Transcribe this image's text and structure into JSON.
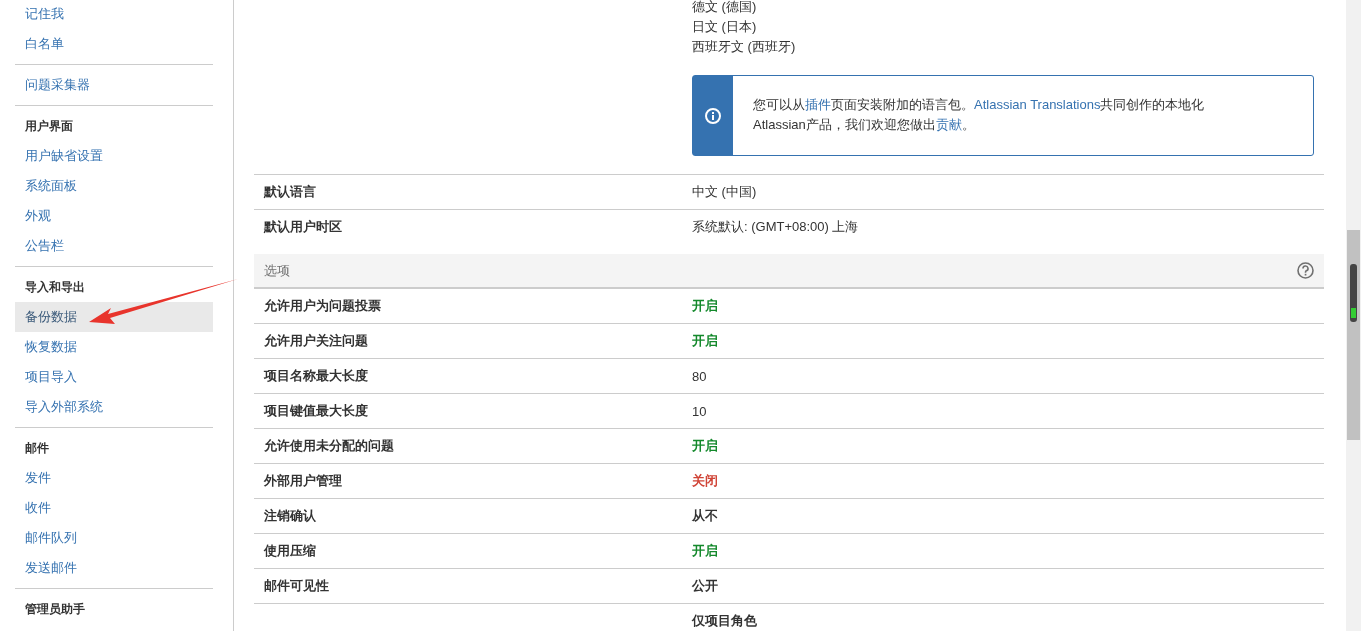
{
  "sidebar": {
    "sections": [
      {
        "items": [
          {
            "label": "记住我",
            "selected": false
          },
          {
            "label": "白名单",
            "selected": false
          }
        ]
      },
      {
        "items": [
          {
            "label": "问题采集器",
            "selected": false
          }
        ]
      },
      {
        "heading": "用户界面",
        "items": [
          {
            "label": "用户缺省设置",
            "selected": false
          },
          {
            "label": "系统面板",
            "selected": false
          },
          {
            "label": "外观",
            "selected": false
          },
          {
            "label": "公告栏",
            "selected": false
          }
        ]
      },
      {
        "heading": "导入和导出",
        "items": [
          {
            "label": "备份数据",
            "selected": true
          },
          {
            "label": "恢复数据",
            "selected": false
          },
          {
            "label": "项目导入",
            "selected": false
          },
          {
            "label": "导入外部系统",
            "selected": false
          }
        ]
      },
      {
        "heading": "邮件",
        "items": [
          {
            "label": "发件",
            "selected": false
          },
          {
            "label": "收件",
            "selected": false
          },
          {
            "label": "邮件队列",
            "selected": false
          },
          {
            "label": "发送邮件",
            "selected": false
          }
        ]
      },
      {
        "heading": "管理员助手"
      }
    ]
  },
  "languages": [
    "德文 (德国)",
    "日文 (日本)",
    "西班牙文 (西班牙)"
  ],
  "info_message": [
    {
      "text": "您可以从"
    },
    {
      "text": "插件",
      "link": true
    },
    {
      "text": "页面安装附加的语言包。"
    },
    {
      "text": "Atlassian Translations",
      "link": true
    },
    {
      "text": "共同创作的本地化Atlassian产品，我们欢迎您做出"
    },
    {
      "text": "贡献",
      "link": true
    },
    {
      "text": "。"
    }
  ],
  "settings": [
    {
      "label": "默认语言",
      "value": "中文 (中国)"
    },
    {
      "label": "默认用户时区",
      "value": "系统默认: (GMT+08:00) 上海"
    }
  ],
  "options": {
    "title": "选项",
    "rows": [
      {
        "label": "允许用户为问题投票",
        "value": "开启",
        "kind": "on"
      },
      {
        "label": "允许用户关注问题",
        "value": "开启",
        "kind": "on"
      },
      {
        "label": "项目名称最大长度",
        "value": "80"
      },
      {
        "label": "项目键值最大长度",
        "value": "10"
      },
      {
        "label": "允许使用未分配的问题",
        "value": "开启",
        "kind": "on"
      },
      {
        "label": "外部用户管理",
        "value": "关闭",
        "kind": "off"
      },
      {
        "label": "注销确认",
        "value": "从不",
        "kind": "strong"
      },
      {
        "label": "使用压缩",
        "value": "开启",
        "kind": "on"
      },
      {
        "label": "邮件可见性",
        "value": "公开",
        "kind": "strong"
      },
      {
        "value": "仅项目角色",
        "kind": "strong"
      }
    ]
  }
}
